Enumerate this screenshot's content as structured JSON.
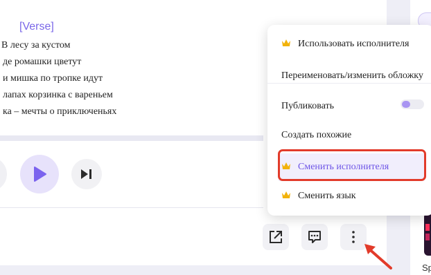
{
  "lyrics": {
    "verse_tag": "[Verse]",
    "lines": [
      "В лесу за кустом",
      "де ромашки цветут",
      "и мишка по тропке идут",
      "лапах корзинка с вареньем",
      "ка – мечты о приключеньях"
    ]
  },
  "player": {
    "play_icon": "play-icon",
    "next_icon": "skip-next-icon"
  },
  "actions": {
    "share_icon": "share-external-icon",
    "comment_icon": "comment-icon",
    "more_icon": "more-vertical-icon"
  },
  "menu": {
    "items": [
      {
        "label": "Использовать исполнителя",
        "icon": "crown-icon"
      },
      {
        "label": "Переименовать/изменить обложку"
      },
      {
        "label": "Публиковать",
        "toggle_on": false
      },
      {
        "label": "Создать похожие"
      },
      {
        "label": "Сменить исполнителя",
        "icon": "crown-icon",
        "highlighted": true
      },
      {
        "label": "Сменить язык",
        "icon": "crown-icon"
      }
    ]
  },
  "sidebar": {
    "caption": "Sp"
  },
  "colors": {
    "accent": "#6c53e6",
    "highlight_border": "#e23b2a",
    "crown": "#f2b20a"
  }
}
